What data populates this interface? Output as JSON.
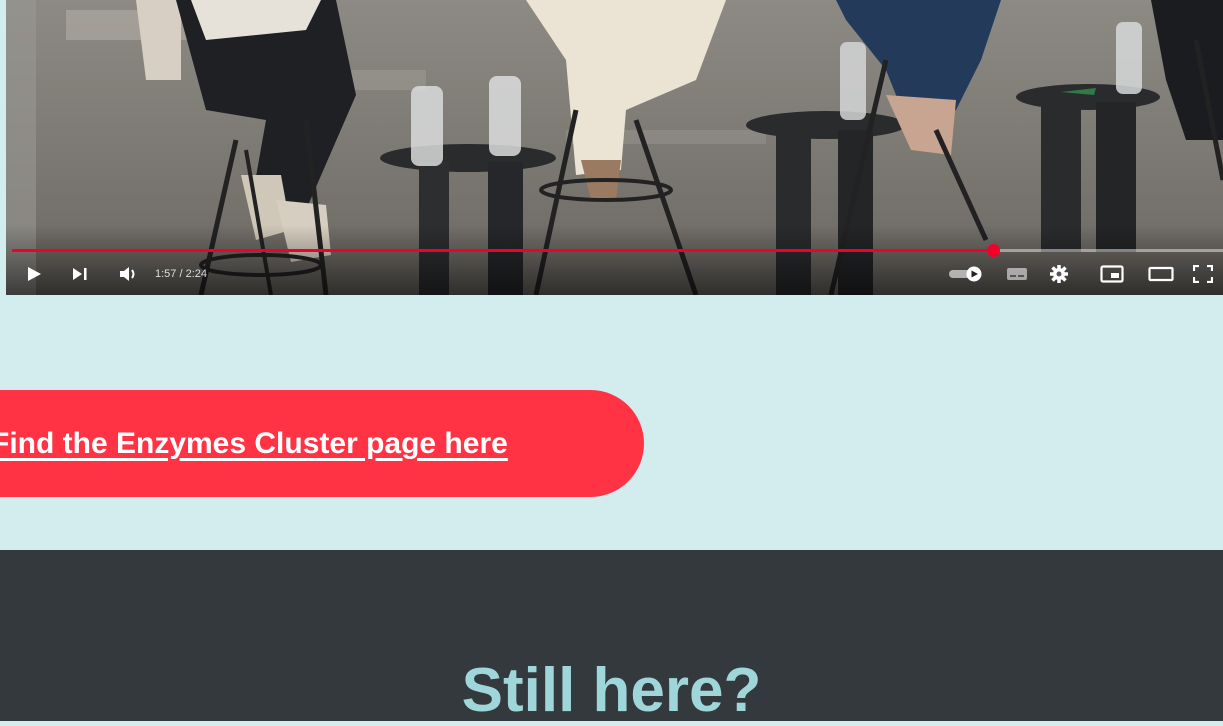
{
  "video": {
    "time_label": "1:57 / 2:24",
    "progress": 0.81,
    "buttons": {
      "play": "play-icon",
      "next": "next-icon",
      "volume": "volume-icon",
      "autoplay": "autoplay-toggle-icon",
      "subtitles": "subtitles-icon",
      "settings": "settings-icon",
      "miniplayer": "miniplayer-icon",
      "theater": "theater-mode-icon",
      "fullscreen": "fullscreen-icon"
    }
  },
  "cta": {
    "label": "Find the Enzymes Cluster page here"
  },
  "footer": {
    "heading": "Still here?"
  },
  "colors": {
    "page_bg": "#d3ecee",
    "accent": "#ff3344",
    "footer_bg": "#33393d",
    "heading": "#9fd6da",
    "progress": "#f2002a"
  }
}
